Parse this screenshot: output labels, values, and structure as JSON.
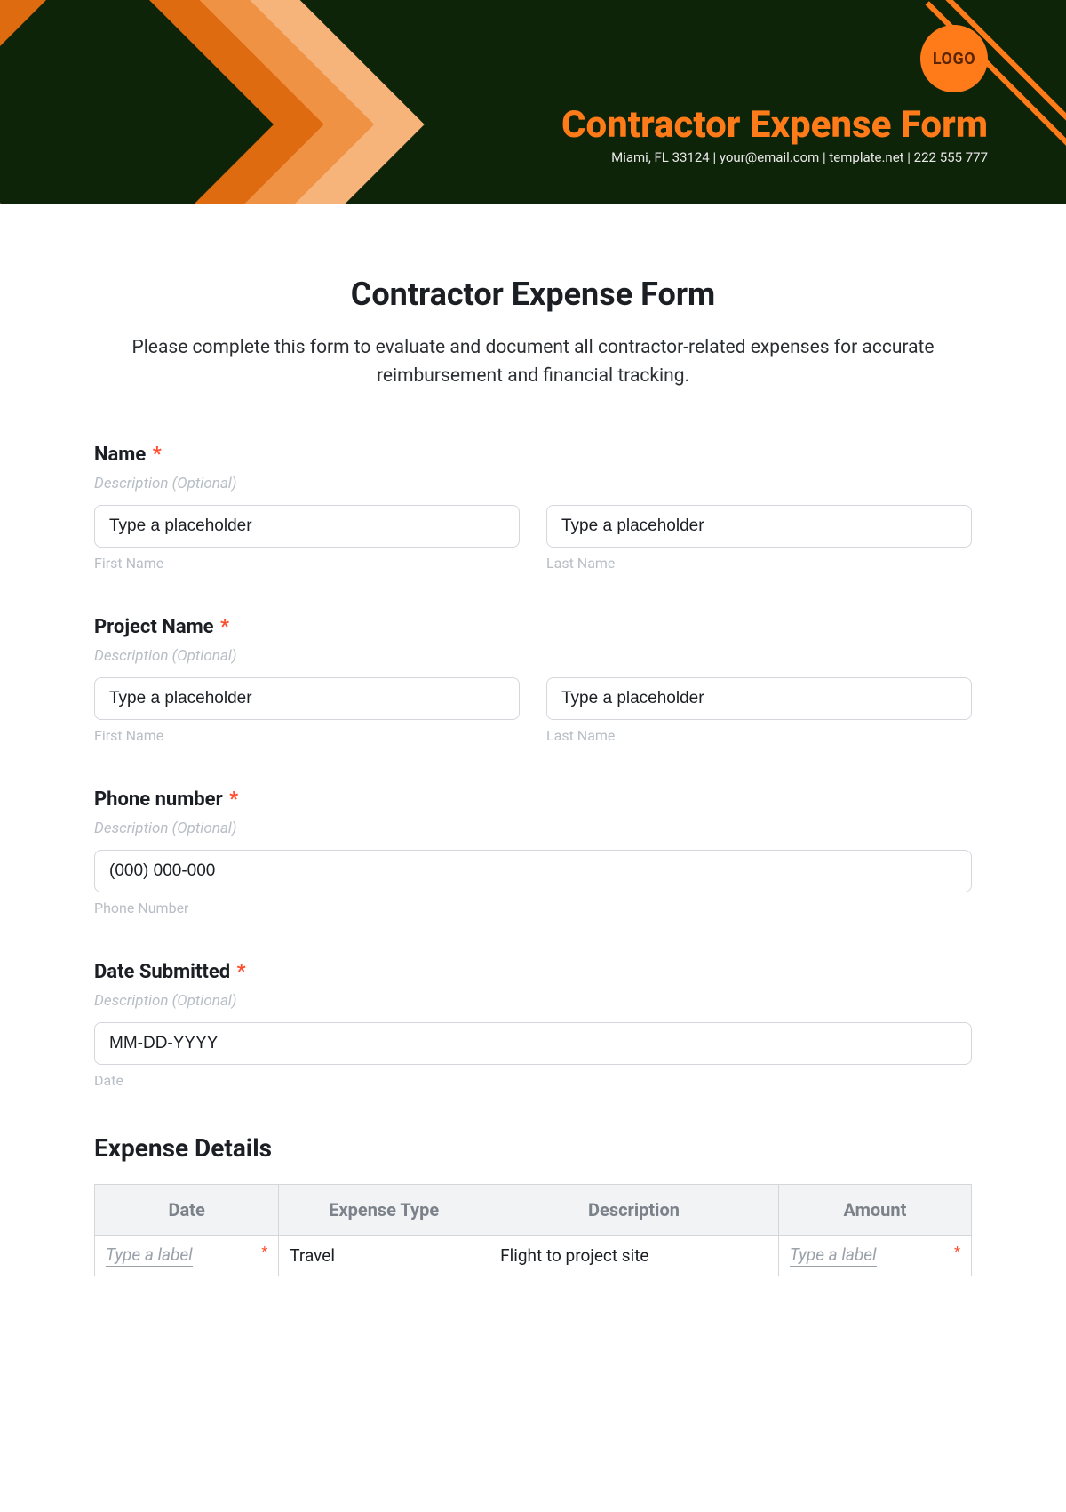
{
  "header": {
    "logo_text": "LOGO",
    "title": "Contractor Expense Form",
    "subtitle": "Miami, FL 33124 | your@email.com | template.net | 222 555 777"
  },
  "form": {
    "title": "Contractor Expense Form",
    "description": "Please complete this form to evaluate and document all contractor-related expenses for accurate reimbursement and financial tracking.",
    "required_mark": "*",
    "desc_hint": "Description (Optional)",
    "name": {
      "label": "Name",
      "first_ph": "Type a placeholder",
      "first_sub": "First Name",
      "last_ph": "Type a placeholder",
      "last_sub": "Last Name"
    },
    "project": {
      "label": "Project Name",
      "first_ph": "Type a placeholder",
      "first_sub": "First Name",
      "last_ph": "Type a placeholder",
      "last_sub": "Last Name"
    },
    "phone": {
      "label": "Phone number",
      "ph": "(000) 000-000",
      "sub": "Phone Number"
    },
    "date": {
      "label": "Date Submitted",
      "ph": "MM-DD-YYYY",
      "sub": "Date"
    },
    "expense": {
      "section_title": "Expense Details",
      "headers": {
        "date": "Date",
        "type": "Expense Type",
        "desc": "Description",
        "amount": "Amount"
      },
      "row1": {
        "date_ph": "Type a label",
        "type": "Travel",
        "desc": "Flight to project site",
        "amount_ph": "Type a label"
      }
    }
  }
}
